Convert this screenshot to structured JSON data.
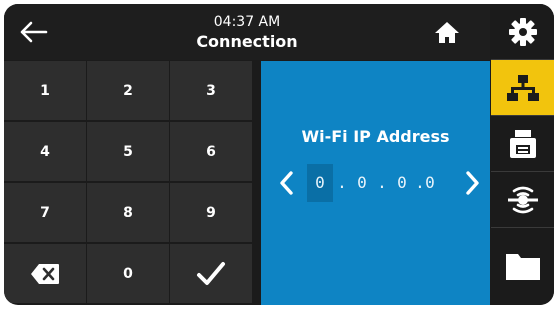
{
  "header": {
    "time": "04:37 AM",
    "title": "Connection"
  },
  "keypad": {
    "keys": [
      "1",
      "2",
      "3",
      "4",
      "5",
      "6",
      "7",
      "8",
      "9",
      "",
      "0",
      ""
    ]
  },
  "wifi": {
    "label": "Wi-Fi IP Address",
    "octets": [
      "0",
      "0",
      "0",
      "0"
    ],
    "separator": "."
  },
  "sidebar": {
    "items": [
      "gear-icon",
      "network-icon",
      "printer-icon",
      "rfid-icon",
      "folder-icon"
    ],
    "active_index": 1
  },
  "colors": {
    "header": "#1e1e1e",
    "key": "#2e2e2e",
    "panel": "#0e84c4",
    "active_segment": "#0a6fa6",
    "sidebar_active": "#f2c40d"
  }
}
